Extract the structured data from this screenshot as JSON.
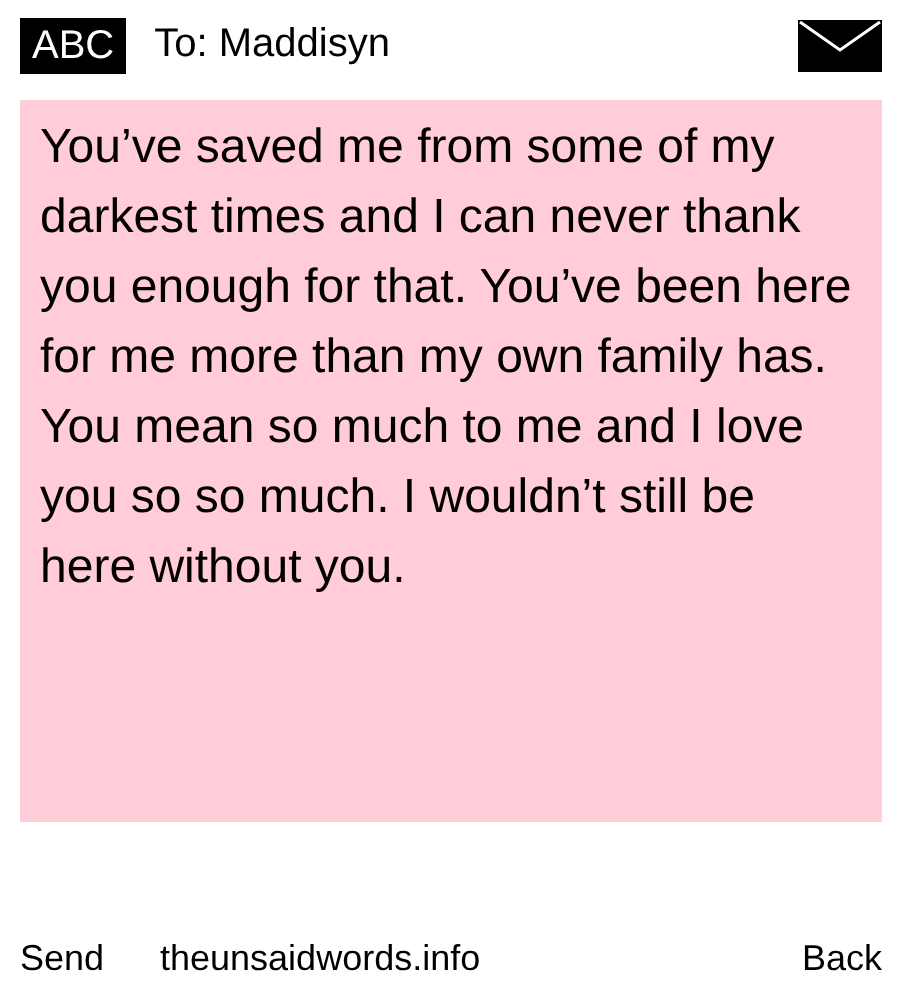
{
  "header": {
    "badge": "ABC",
    "recipient": "To: Maddisyn"
  },
  "message": {
    "text": "You’ve saved me from some of my darkest times and I can never thank you enough for that. You’ve been here for me more than my own family has. You mean so much to me and I love you so so much. I wouldn’t still be here without you."
  },
  "footer": {
    "send": "Send",
    "site": "theunsaidwords.info",
    "back": "Back"
  }
}
